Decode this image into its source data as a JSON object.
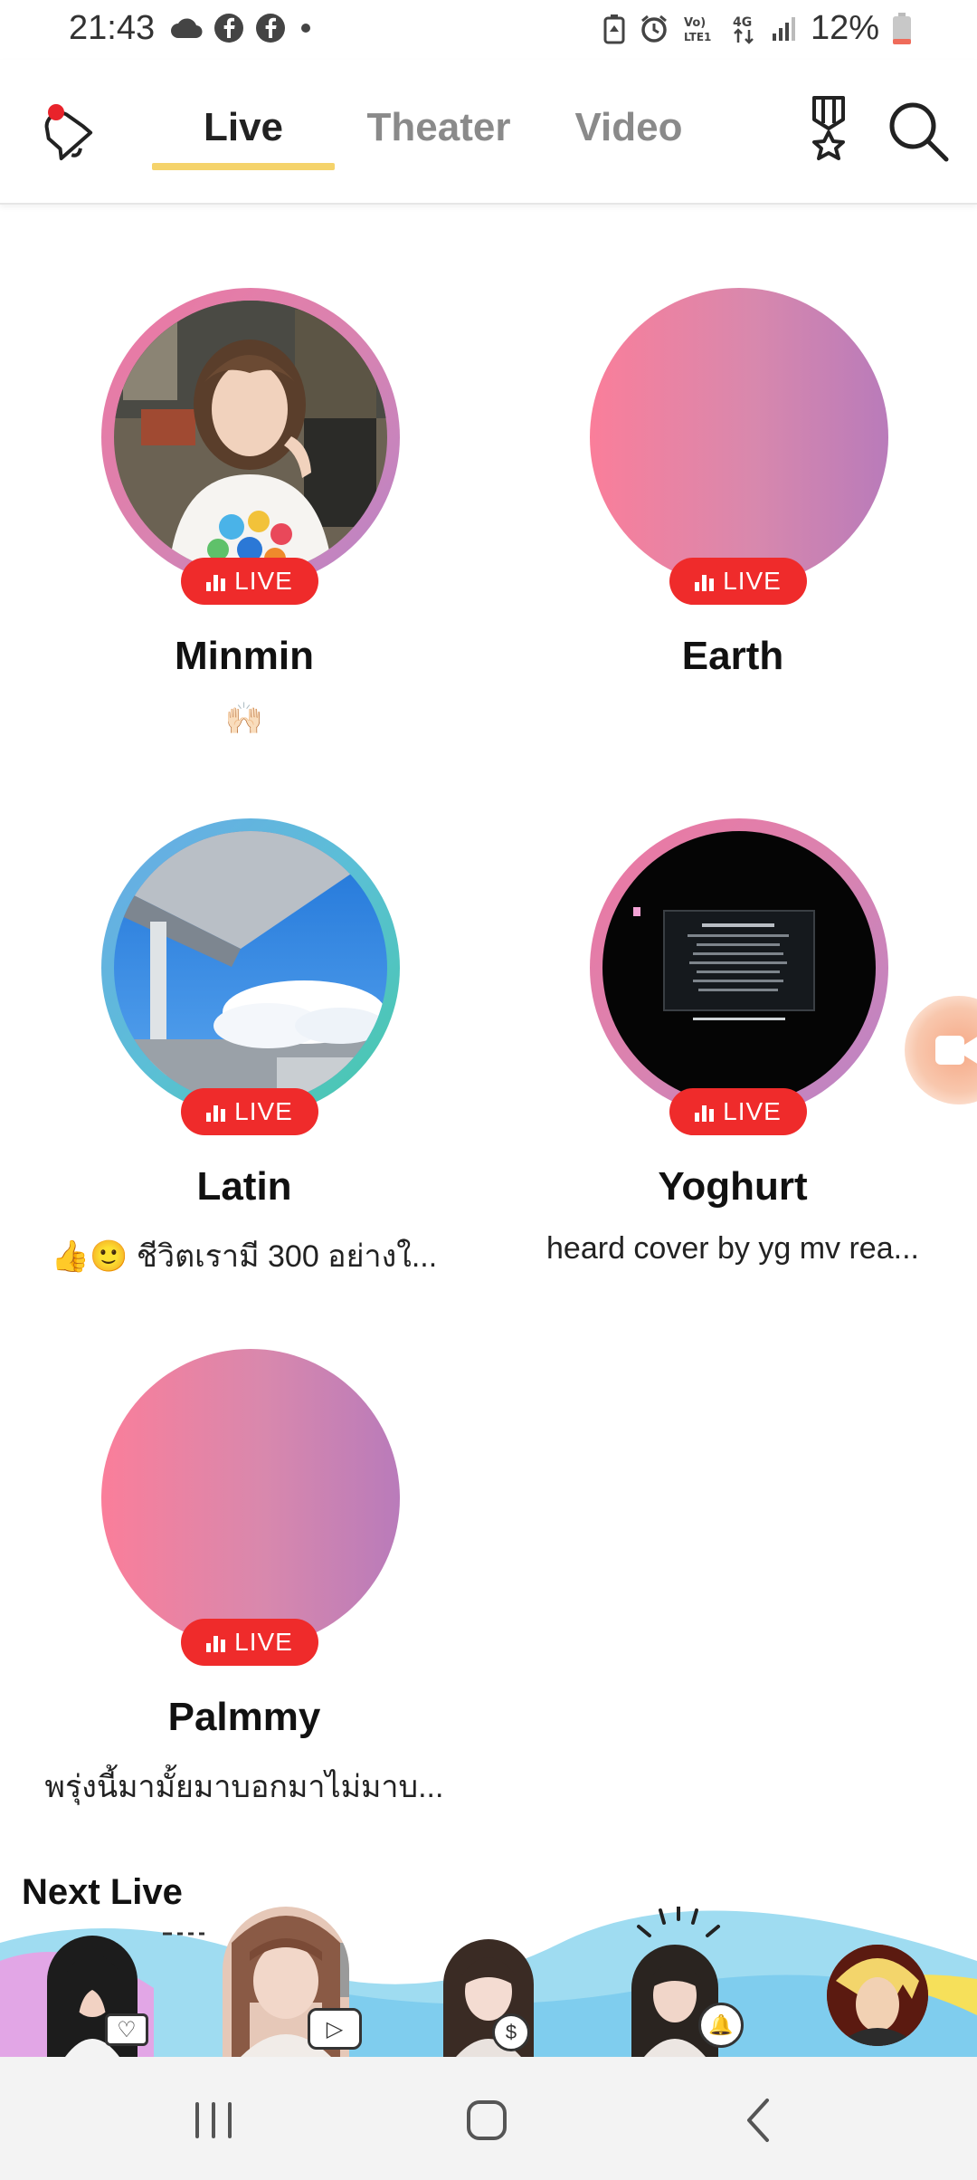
{
  "status_bar": {
    "time": "21:43",
    "battery": "12%",
    "network_label": "4G",
    "volte_label": "Vo) LTE1"
  },
  "tabs": [
    {
      "label": "Live",
      "active": true
    },
    {
      "label": "Theater",
      "active": false
    },
    {
      "label": "Video",
      "active": false
    }
  ],
  "lives": [
    {
      "name": "Minmin",
      "subtitle": "🙌🏻",
      "badge": "LIVE",
      "thumb": "photo-girl"
    },
    {
      "name": "Earth",
      "subtitle": "",
      "badge": "LIVE",
      "thumb": "gradient"
    },
    {
      "name": "Latin",
      "subtitle": "👍🙂 ชีวิตเรามี 300 อย่างใ...",
      "badge": "LIVE",
      "thumb": "photo-sky"
    },
    {
      "name": "Yoghurt",
      "subtitle": "heard cover by yg mv rea...",
      "badge": "LIVE",
      "thumb": "video-screen"
    },
    {
      "name": "Palmmy",
      "subtitle": "พรุ่งนี้มามั้ยมาบอกมาไม่มาบ...",
      "badge": "LIVE",
      "thumb": "gradient"
    }
  ],
  "next_live": {
    "title": "Next Live",
    "avatar_icons": [
      "heart-icon",
      "play-icon",
      "coin-icon",
      "bell-icon",
      "anime-avatar"
    ]
  },
  "colors": {
    "live_badge": "#ef2b2b",
    "tab_underline": "#f5d36b",
    "gradient_start": "#fa7e9a",
    "gradient_end": "#b97bba"
  }
}
